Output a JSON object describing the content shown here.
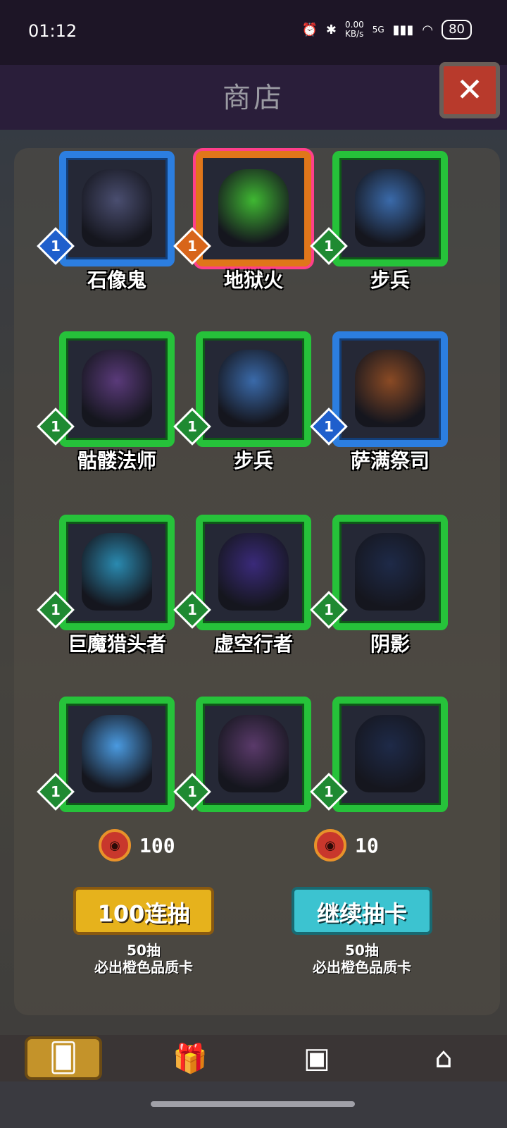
{
  "status_bar": {
    "time": "01:12",
    "net_speed": "0.00\nKB/s",
    "signal": "5G",
    "battery": "80"
  },
  "header": {
    "title": "商店",
    "close_icon": "close-icon"
  },
  "cards": [
    {
      "name": "石像鬼",
      "level": "1",
      "rarity": "blue",
      "art_color": "#4a4e70"
    },
    {
      "name": "地狱火",
      "level": "1",
      "rarity": "orange",
      "art_color": "#3fb832"
    },
    {
      "name": "步兵",
      "level": "1",
      "rarity": "green",
      "art_color": "#3a6aaa"
    },
    {
      "name": "骷髅法师",
      "level": "1",
      "rarity": "green",
      "art_color": "#5a3a7a"
    },
    {
      "name": "步兵",
      "level": "1",
      "rarity": "green",
      "art_color": "#3a6aaa"
    },
    {
      "name": "萨满祭司",
      "level": "1",
      "rarity": "blue",
      "art_color": "#8a4a24"
    },
    {
      "name": "巨魔猎头者",
      "level": "1",
      "rarity": "green",
      "art_color": "#2a8ab0"
    },
    {
      "name": "虚空行者",
      "level": "1",
      "rarity": "green",
      "art_color": "#3a2a7a"
    },
    {
      "name": "阴影",
      "level": "1",
      "rarity": "green",
      "art_color": "#1e2a48"
    },
    {
      "name": "",
      "level": "1",
      "rarity": "green",
      "art_color": "#4a9ae0"
    },
    {
      "name": "",
      "level": "1",
      "rarity": "green",
      "art_color": "#5a3a6a"
    },
    {
      "name": "",
      "level": "1",
      "rarity": "green",
      "art_color": "#1e2a48"
    }
  ],
  "draw": {
    "left": {
      "cost": "100",
      "label": "100连抽",
      "note_line1": "50抽",
      "note_line2": "必出橙色品质卡"
    },
    "right": {
      "cost": "10",
      "label": "继续抽卡",
      "note_line1": "50抽",
      "note_line2": "必出橙色品质卡"
    }
  },
  "nav": [
    {
      "name": "cards",
      "icon": "card-icon"
    },
    {
      "name": "gift",
      "icon": "gift-icon"
    },
    {
      "name": "chest",
      "icon": "chest-icon"
    },
    {
      "name": "shop",
      "icon": "shop-icon"
    }
  ]
}
